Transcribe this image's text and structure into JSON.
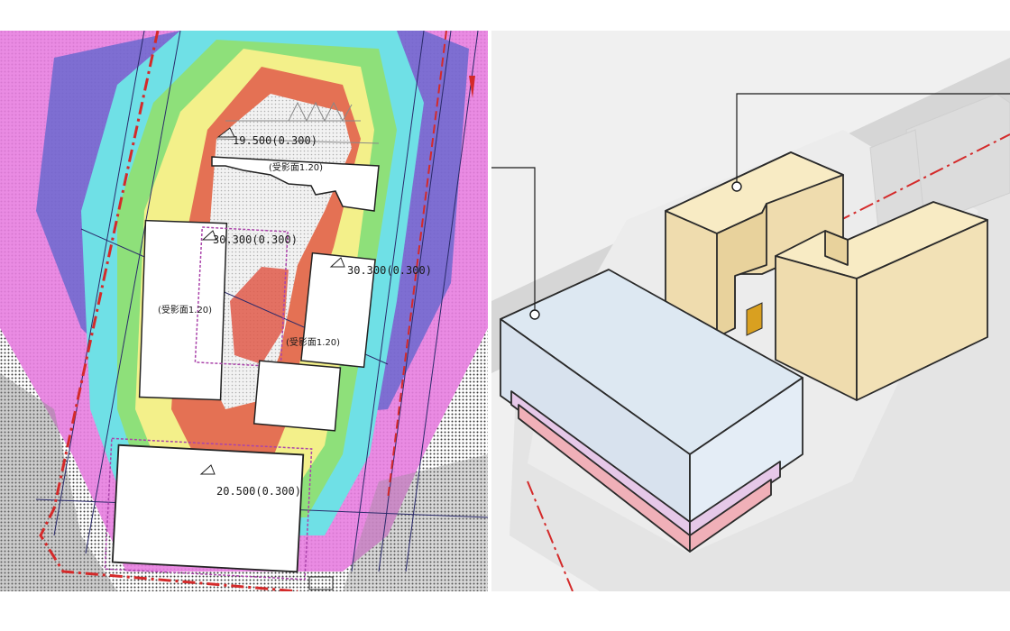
{
  "colors": {
    "magenta": "#e87ee0",
    "blue": "#5560c8",
    "cyan": "#6fe0e6",
    "green": "#8ee07a",
    "yellow": "#f3f08a",
    "red": "#e05a4a",
    "pale_blue_block": "#dde8f2",
    "pink_podium": "#f0b0b8",
    "lavender_podium": "#e6c8e8",
    "tan_block": "#f8ebc4",
    "red_line": "#d42a2a"
  },
  "plan": {
    "labels": {
      "elev_top": "19.500(0.300)",
      "shadow_top": "(受影面1.20)",
      "elev_mid_left": "30.300(0.300)",
      "shadow_mid_left": "(受影面1.20)",
      "elev_mid_right": "30.300(0.300)",
      "shadow_mid_right": "(受影面1.20)",
      "elev_bottom": "20.500(0.300)"
    }
  }
}
